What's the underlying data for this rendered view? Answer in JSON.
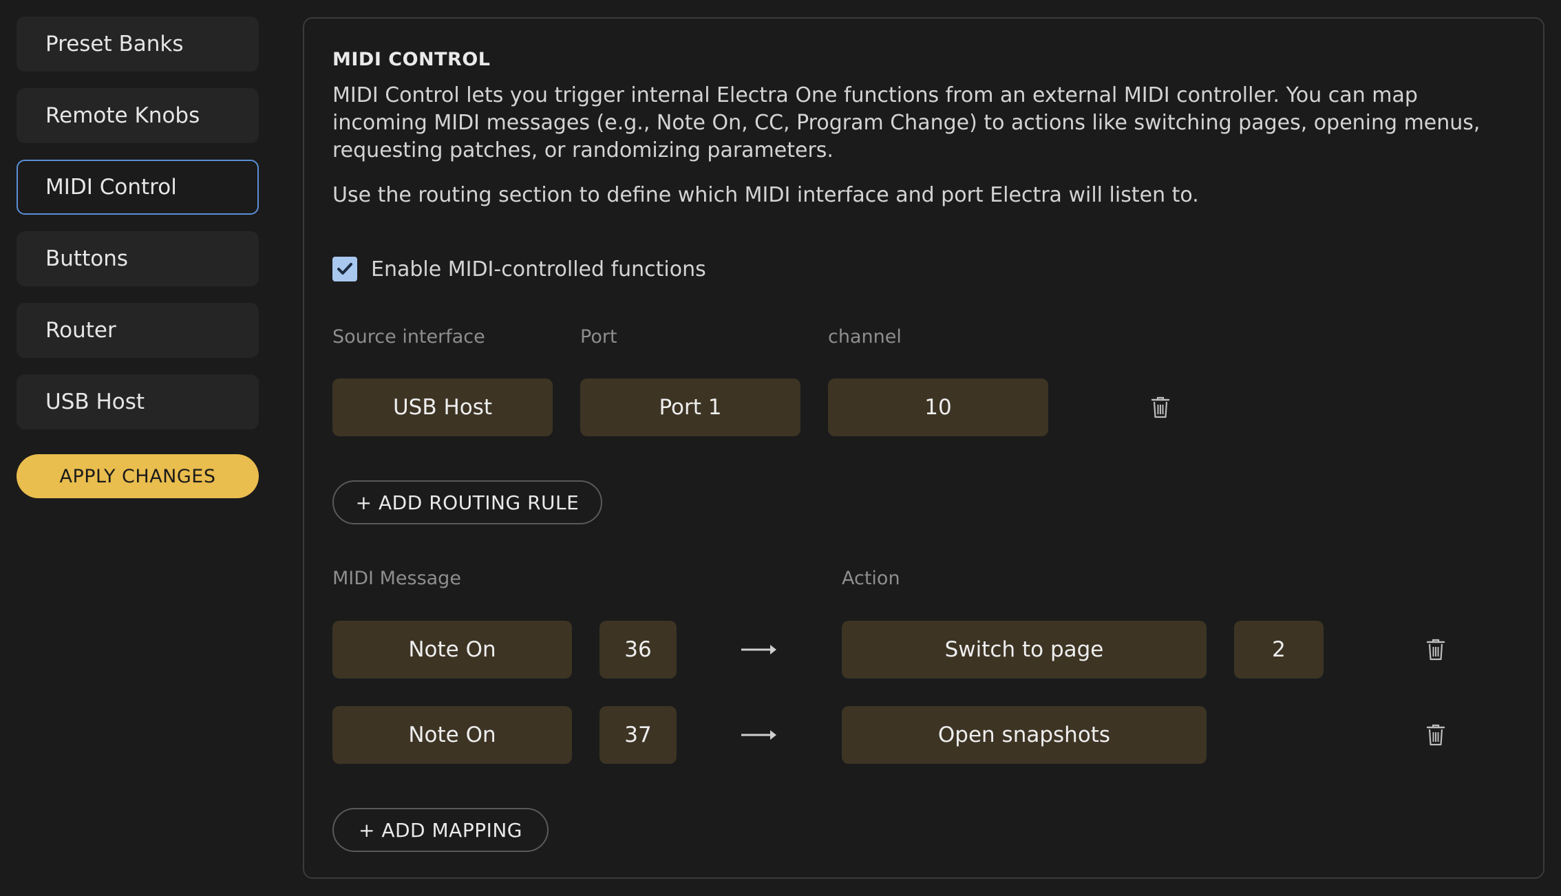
{
  "sidebar": {
    "items": [
      {
        "label": "Preset Banks",
        "active": false
      },
      {
        "label": "Remote Knobs",
        "active": false
      },
      {
        "label": "MIDI Control",
        "active": true
      },
      {
        "label": "Buttons",
        "active": false
      },
      {
        "label": "Router",
        "active": false
      },
      {
        "label": "USB Host",
        "active": false
      }
    ],
    "apply_label": "APPLY CHANGES"
  },
  "panel": {
    "title": "MIDI CONTROL",
    "description": "MIDI Control lets you trigger internal Electra One functions from an external MIDI controller. You can map incoming MIDI messages (e.g., Note On, CC, Program Change) to actions like switching pages, opening menus, requesting patches, or randomizing parameters.",
    "description2": "Use the routing section to define which MIDI interface and port Electra will listen to.",
    "enable_label": "Enable MIDI-controlled functions",
    "enable_checked": true,
    "routing": {
      "headers": {
        "source": "Source interface",
        "port": "Port",
        "channel": "channel"
      },
      "rules": [
        {
          "source": "USB Host",
          "port": "Port 1",
          "channel": "10"
        }
      ],
      "add_label": "+ ADD ROUTING RULE"
    },
    "mapping": {
      "headers": {
        "message": "MIDI Message",
        "action": "Action"
      },
      "rows": [
        {
          "message": "Note On",
          "value": "36",
          "action": "Switch to page",
          "param": "2"
        },
        {
          "message": "Note On",
          "value": "37",
          "action": "Open snapshots",
          "param": ""
        }
      ],
      "add_label": "+ ADD MAPPING"
    }
  },
  "colors": {
    "accent": "#e9bd4e",
    "active_border": "#5b8fd6",
    "pill_bg": "#3d3424",
    "checkbox": "#a9c8f0"
  },
  "icons": {
    "delete": "trash-icon",
    "arrow": "arrow-right-icon",
    "check": "checkmark-icon"
  }
}
